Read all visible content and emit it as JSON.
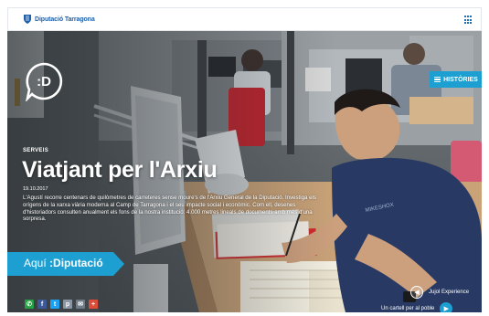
{
  "header": {
    "brand_name": "Diputació Tarragona",
    "menu_icon": "grid-menu-icon"
  },
  "hero": {
    "logo_text": ":D",
    "histories_button": "HISTÒRIES",
    "category": "SERVEIS",
    "title": "Viatjant per l'Arxiu",
    "date": "19.10.2017",
    "description": "L'Agustí recorre centenars de quilòmetres de carreteres sense moure's de l'Arxiu General de la Diputació. Investiga els orígens de la xarxa viària moderna al Camp de Tarragona i el seu impacte social i econòmic. Com ell, desenes d'historiadors consulten anualment els fons de la nostra institució: 4.000 metres lineals de documents amb més d'una sorpresa.",
    "aqui_prefix": "Aquí",
    "aqui_brand": ":Diputació",
    "next_links": [
      {
        "label": "Jujol Experience",
        "icon": "arrow-left-icon",
        "glyph": "◀"
      },
      {
        "label": "Un cartell per al poble",
        "icon": "arrow-right-icon",
        "glyph": "▶"
      }
    ]
  },
  "share": [
    {
      "name": "whatsapp-icon",
      "glyph": "✆",
      "color": "#25a244"
    },
    {
      "name": "facebook-icon",
      "glyph": "f",
      "color": "#3b5998"
    },
    {
      "name": "twitter-icon",
      "glyph": "t",
      "color": "#1da1f2"
    },
    {
      "name": "pinterest-icon",
      "glyph": "p",
      "color": "#8a96a3"
    },
    {
      "name": "email-icon",
      "glyph": "✉",
      "color": "#6f7b86"
    },
    {
      "name": "google-plus-icon",
      "glyph": "+",
      "color": "#dd4b39"
    }
  ],
  "colors": {
    "accent": "#1d9fd1",
    "brand_blue": "#1f5fa8"
  }
}
